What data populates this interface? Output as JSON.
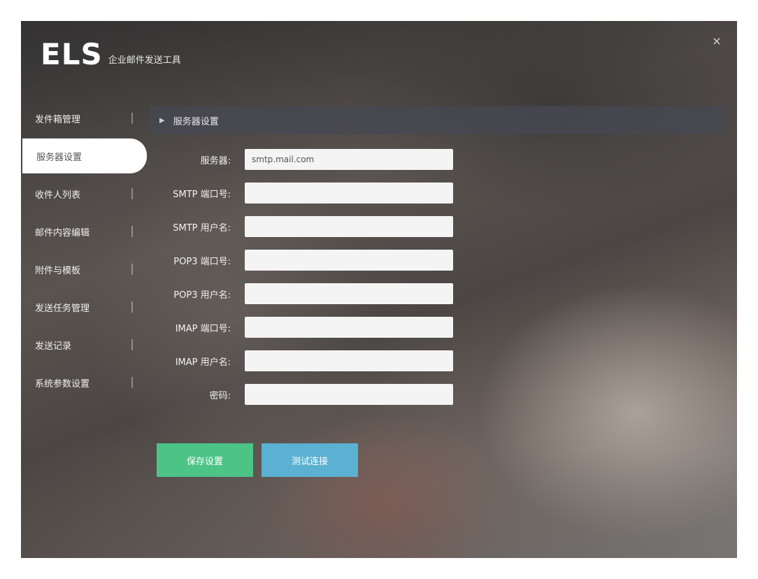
{
  "window": {
    "close_glyph": "×"
  },
  "logo": {
    "mark": "ELS",
    "subtitle": "企业邮件发送工具"
  },
  "sidebar": {
    "items": [
      {
        "label": "发件箱管理"
      },
      {
        "label": "服务器设置"
      },
      {
        "label": "收件人列表"
      },
      {
        "label": "邮件内容编辑"
      },
      {
        "label": "附件与模板"
      },
      {
        "label": "发送任务管理"
      },
      {
        "label": "发送记录"
      },
      {
        "label": "系统参数设置"
      }
    ],
    "active_index": 1
  },
  "section": {
    "title": "服务器设置",
    "icon": "chevron-right-icon"
  },
  "form": {
    "fields": [
      {
        "label": "服务器:",
        "value": "smtp.mail.com",
        "placeholder": ""
      },
      {
        "label": "SMTP 端口号:",
        "value": "",
        "placeholder": ""
      },
      {
        "label": "SMTP 用户名:",
        "value": "",
        "placeholder": ""
      },
      {
        "label": "POP3 端口号:",
        "value": "",
        "placeholder": ""
      },
      {
        "label": "POP3 用户名:",
        "value": "",
        "placeholder": ""
      },
      {
        "label": "IMAP 端口号:",
        "value": "",
        "placeholder": ""
      },
      {
        "label": "IMAP 用户名:",
        "value": "",
        "placeholder": ""
      },
      {
        "label": "密码:",
        "value": "",
        "placeholder": ""
      }
    ]
  },
  "actions": {
    "save_label": "保存设置",
    "test_label": "测试连接"
  },
  "colors": {
    "save_button": "#4cc486",
    "test_button": "#5bb1d1",
    "section_header": "#464852"
  }
}
